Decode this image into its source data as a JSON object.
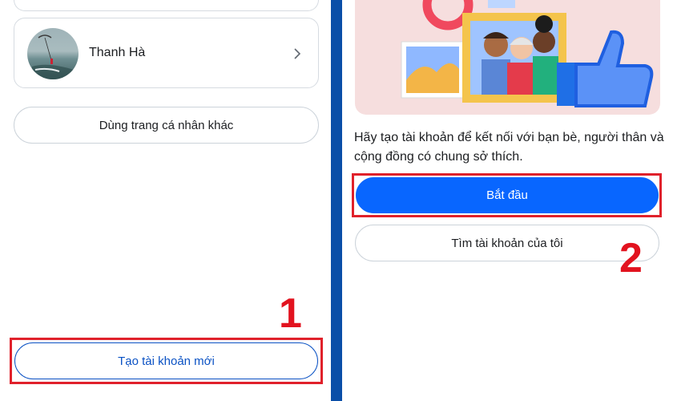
{
  "left_screen": {
    "profile": {
      "name": "Thanh Hà",
      "avatar_icon": "profile-photo",
      "chevron_icon": "chevron-right-icon"
    },
    "other_profile_button": "Dùng trang cá nhân khác",
    "create_account_button": "Tạo tài khoản mới",
    "step_marker": "1"
  },
  "right_screen": {
    "illustration_icon": "friends-thumbs-up-illustration",
    "description": "Hãy tạo tài khoản để kết nối với bạn bè, người thân và cộng đồng có chung sở thích.",
    "start_button": "Bắt đầu",
    "find_account_button": "Tìm tài khoản của tôi",
    "step_marker": "2"
  },
  "colors": {
    "primary_blue": "#0866ff",
    "highlight_red": "#e0212b",
    "link_blue": "#0b52c4",
    "divider_blue": "#0a4ea8"
  }
}
